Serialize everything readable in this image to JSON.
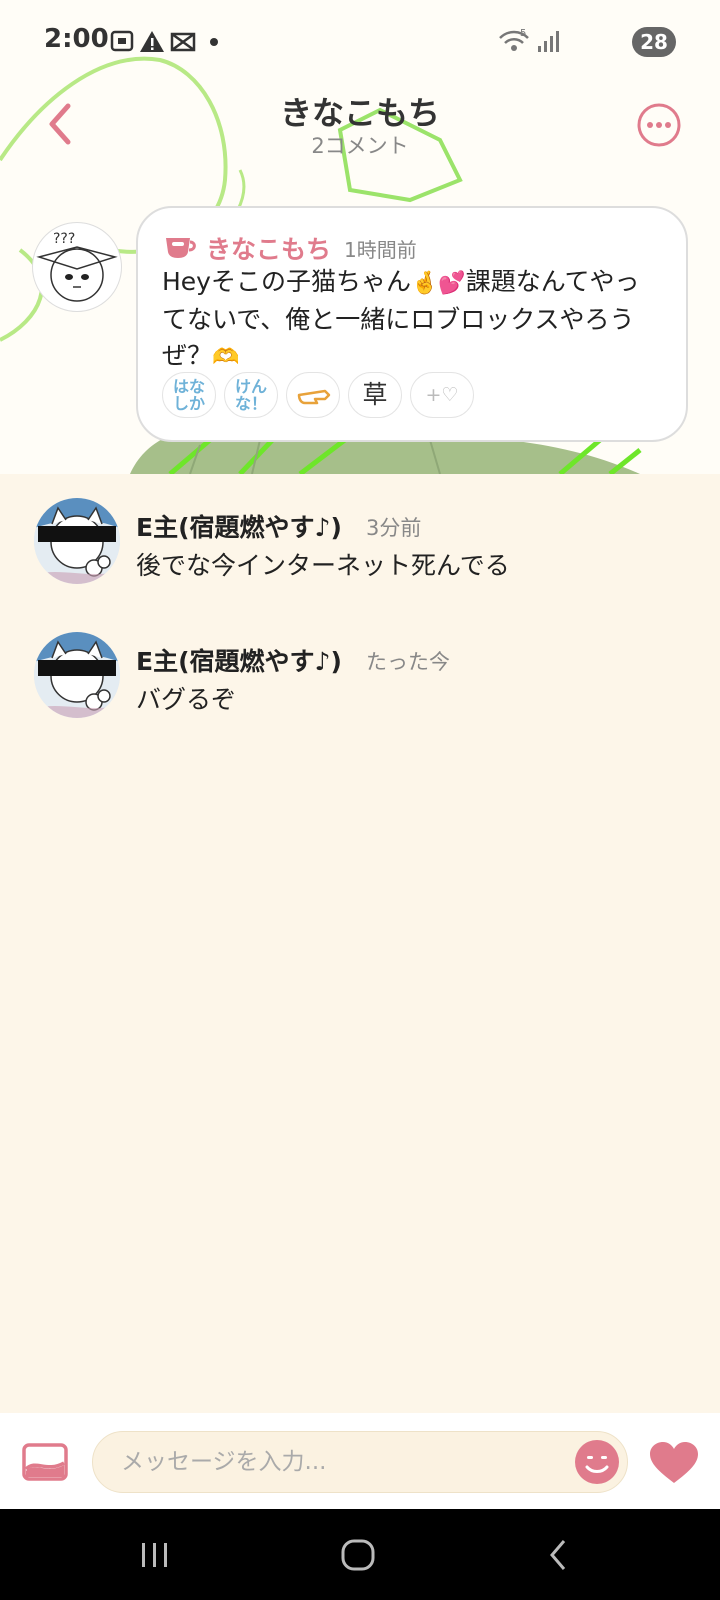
{
  "status_bar": {
    "time": "2:00",
    "battery": "28",
    "icons_left": [
      "screenshot-icon",
      "warning-icon",
      "capcut-icon",
      "dot-icon"
    ],
    "icons_right": [
      "wifi-icon",
      "signal-icon",
      "battery-icon"
    ]
  },
  "header": {
    "title": "きなこもち",
    "subtitle": "2コメント"
  },
  "post": {
    "author": "きなこもち",
    "time": "1時間前",
    "text_part1": "Heyそこの子猫ちゃん",
    "emoji1": "🤞",
    "emoji2": "💕",
    "text_part2": "課題なんてやってないで、俺と一緒にロブロックスやろうぜ？",
    "emoji3": "🫶",
    "reactions": [
      {
        "label_top": "はな",
        "label_bottom": "しか"
      },
      {
        "label_top": "けん",
        "label_bottom": "な！"
      },
      {
        "label": "👈"
      },
      {
        "label": "草"
      },
      {
        "label": "+♡"
      }
    ]
  },
  "comments": [
    {
      "author": "E主(宿題燃やす♪)",
      "time": "3分前",
      "text": "後でな今インターネット死んでる"
    },
    {
      "author": "E主(宿題燃やす♪)",
      "time": "たった今",
      "text": "バグるぞ"
    }
  ],
  "input": {
    "placeholder": "メッセージを入力..."
  },
  "colors": {
    "accent": "#e07b8c",
    "background": "#fdf6e9",
    "reaction_text": "#6fb2d8"
  }
}
